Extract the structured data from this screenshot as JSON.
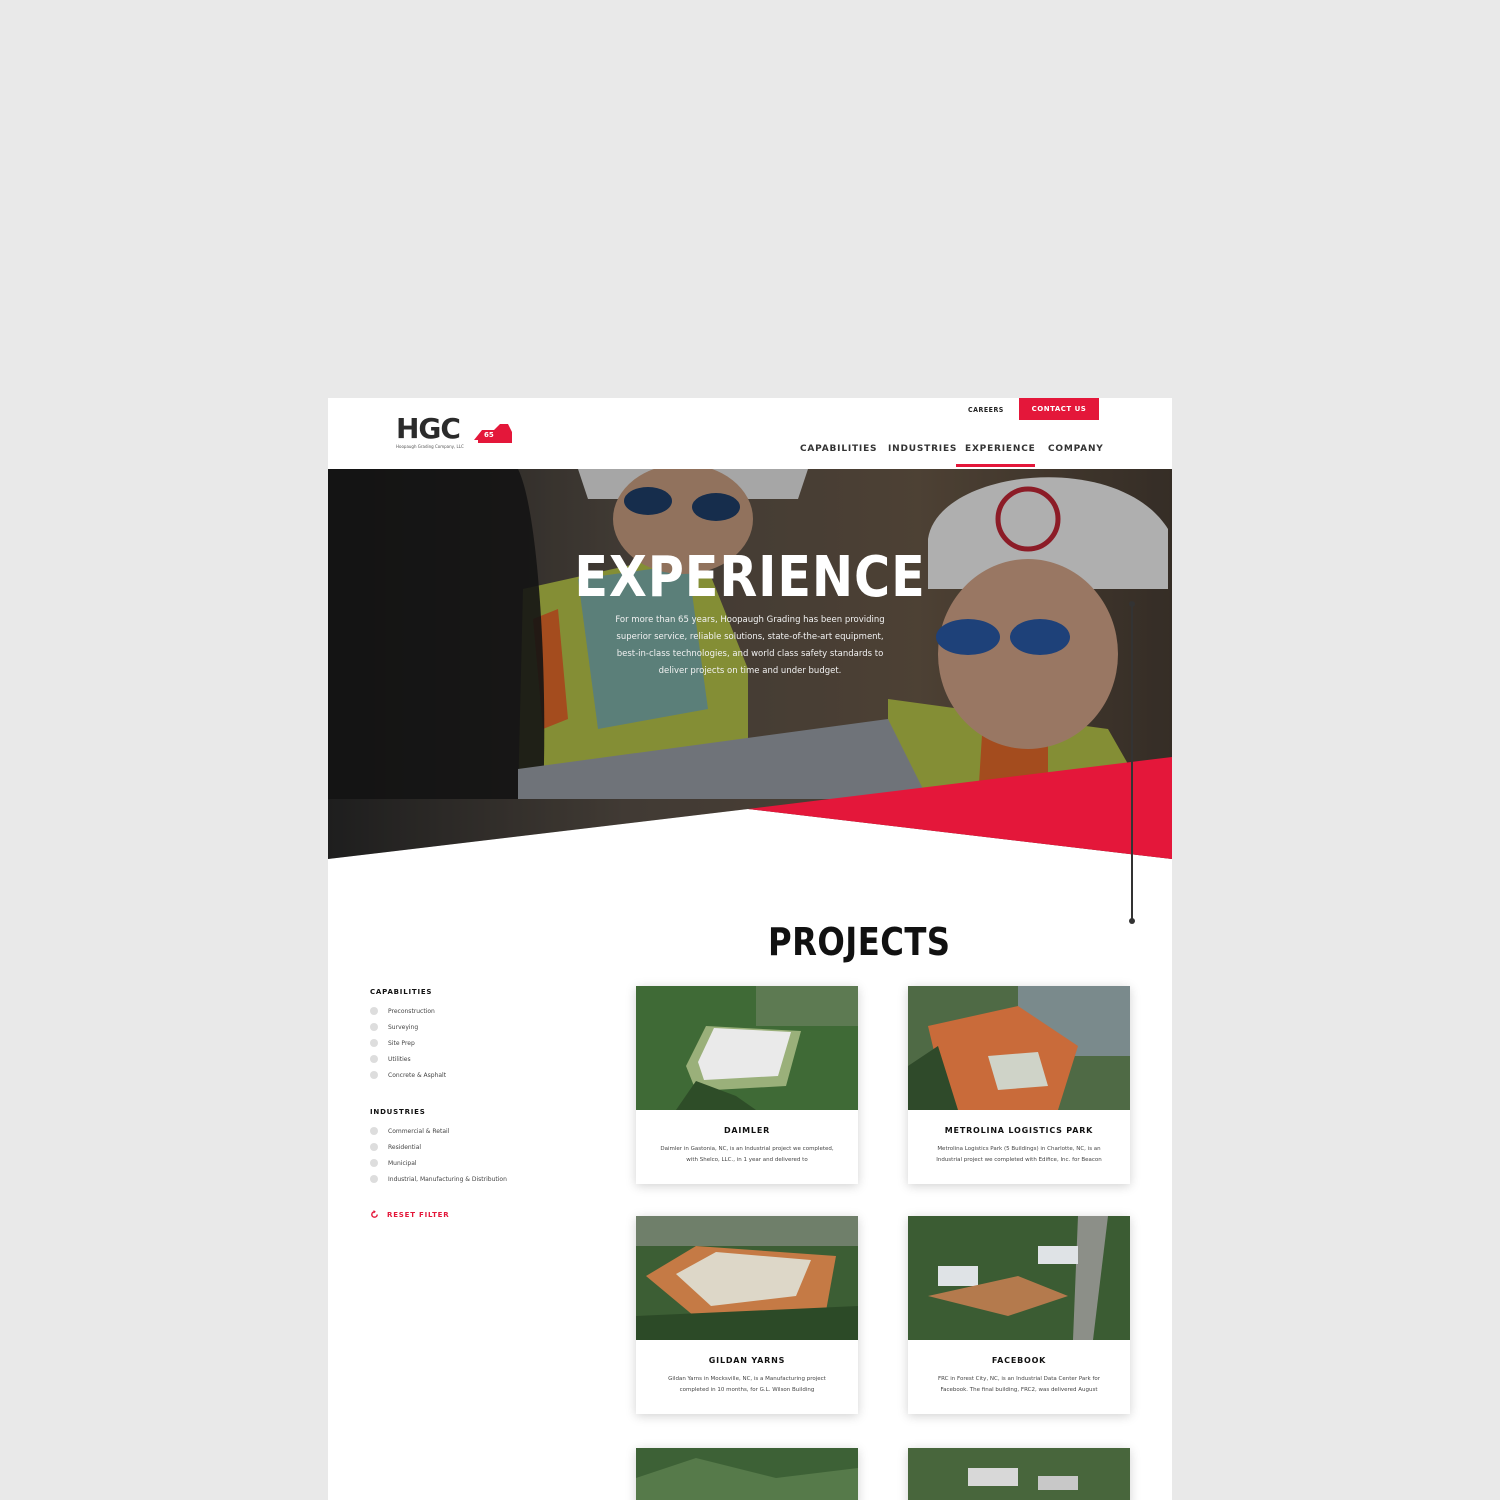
{
  "brand": {
    "logo_letters": "HGC",
    "logo_subtitle": "Hoopaugh Grading Company, LLC",
    "accent_color": "#e4173a"
  },
  "header": {
    "careers": "CAREERS",
    "contact": "CONTACT US",
    "nav": [
      "CAPABILITIES",
      "INDUSTRIES",
      "EXPERIENCE",
      "COMPANY"
    ],
    "active_nav": "EXPERIENCE"
  },
  "hero": {
    "title": "EXPERIENCE",
    "text": "For more than 65 years, Hoopaugh Grading has been providing superior service, reliable solutions, state-of-the-art equipment, best-in-class technologies, and world class safety standards to deliver projects on time and under budget."
  },
  "projects": {
    "title": "PROJECTS",
    "cards": [
      {
        "name": "DAIMLER",
        "desc": "Daimler in Gastonia, NC, is an Industrial project we completed, with Shelco, LLC., in 1 year and delivered to"
      },
      {
        "name": "METROLINA LOGISTICS PARK",
        "desc": "Metrolina Logistics Park (5 Buildings) in Charlotte, NC, is an Industrial project we completed with Edifice, Inc. for Beacon"
      },
      {
        "name": "GILDAN YARNS",
        "desc": "Gildan Yarns in Mocksville, NC, is a Manufacturing project completed in 10 months, for G.L. Wilson Building"
      },
      {
        "name": "FACEBOOK",
        "desc": "FRC in Forest City, NC, is an Industrial Data Center Park for Facebook. The final building, FRC2, was delivered August"
      }
    ]
  },
  "filters": {
    "capabilities": {
      "heading": "CAPABILITIES",
      "items": [
        "Preconstruction",
        "Surveying",
        "Site Prep",
        "Utilities",
        "Concrete & Asphalt"
      ]
    },
    "industries": {
      "heading": "INDUSTRIES",
      "items": [
        "Commercial & Retail",
        "Residential",
        "Municipal",
        "Industrial, Manufacturing & Distribution"
      ]
    },
    "reset": "RESET FILTER"
  }
}
